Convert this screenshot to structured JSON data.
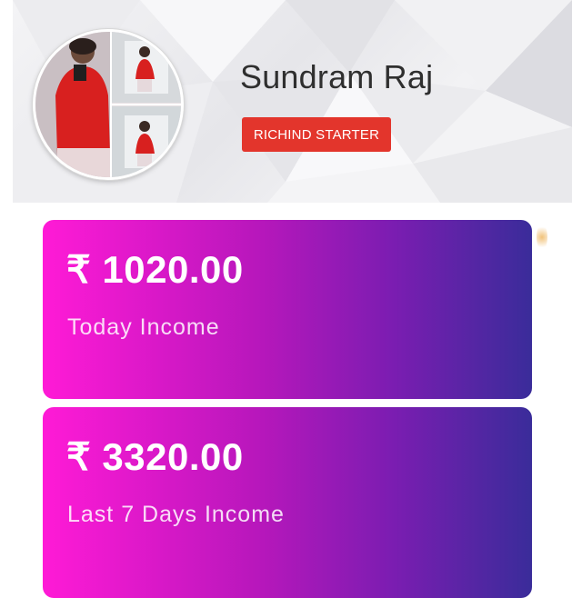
{
  "profile": {
    "name": "Sundram Raj",
    "rank": "RICHIND STARTER"
  },
  "income": {
    "today": {
      "amount": "₹ 1020.00",
      "label": "Today Income"
    },
    "last7": {
      "amount": "₹ 3320.00",
      "label": "Last 7 Days Income"
    }
  },
  "colors": {
    "badge": "#e3352c",
    "card_gradient_start": "#ff1ad6",
    "card_gradient_end": "#3a2c9a",
    "name_text": "#2f2f2f"
  }
}
